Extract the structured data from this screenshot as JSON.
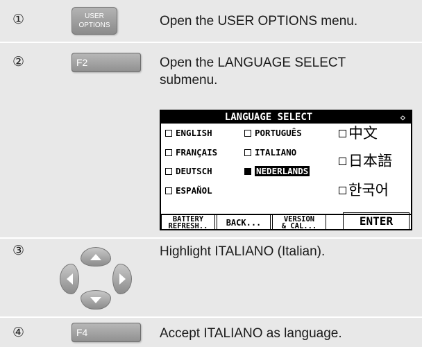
{
  "steps": [
    {
      "number": "①",
      "description": "Open the USER OPTIONS menu.",
      "button": {
        "line1": "USER",
        "line2": "OPTIONS"
      }
    },
    {
      "number": "②",
      "description": "Open the LANGUAGE SELECT submenu.",
      "button": {
        "label": "F2"
      }
    },
    {
      "number": "③",
      "description": "Highlight ITALIANO (Italian).",
      "button": {
        "icon": "arrow-keypad-icon"
      }
    },
    {
      "number": "④",
      "description": "Accept ITALIANO as language.",
      "button": {
        "label": "F4"
      }
    }
  ],
  "lcd": {
    "title": "LANGUAGE SELECT",
    "title_symbol": "◇",
    "options": {
      "english": "ENGLISH",
      "francais": "FRANÇAIS",
      "deutsch": "DEUTSCH",
      "espanol": "ESPAÑOL",
      "portugues": "PORTUGUÊS",
      "italiano": "ITALIANO",
      "nederlands": "NEDERLANDS",
      "chinese": "中文",
      "japanese": "日本語",
      "korean": "한국어"
    },
    "selected": "NEDERLANDS",
    "softkeys": {
      "battery_line1": "BATTERY",
      "battery_line2": "REFRESH..",
      "back": "BACK...",
      "version_line1": "VERSION",
      "version_line2": "& CAL...",
      "enter": "ENTER"
    }
  }
}
